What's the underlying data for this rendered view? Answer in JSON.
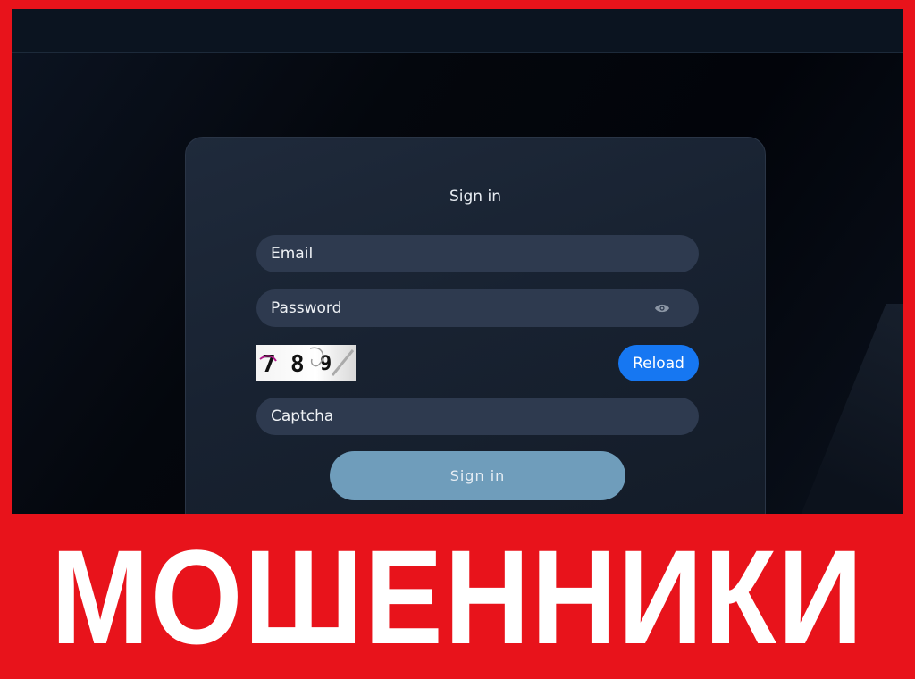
{
  "login": {
    "title": "Sign in",
    "email_placeholder": "Email",
    "password_placeholder": "Password",
    "captcha_digits": [
      "7",
      "8",
      "9"
    ],
    "reload_label": "Reload",
    "captcha_placeholder": "Captcha",
    "submit_label": "Sign in"
  },
  "banner": {
    "text": "МОШЕННИКИ"
  },
  "colors": {
    "frame": "#e8131b",
    "card": "#1a2433",
    "field": "#2e3a4f",
    "reload": "#1677f2",
    "submit": "#6f9dbb"
  },
  "icons": [
    "eye-icon"
  ]
}
